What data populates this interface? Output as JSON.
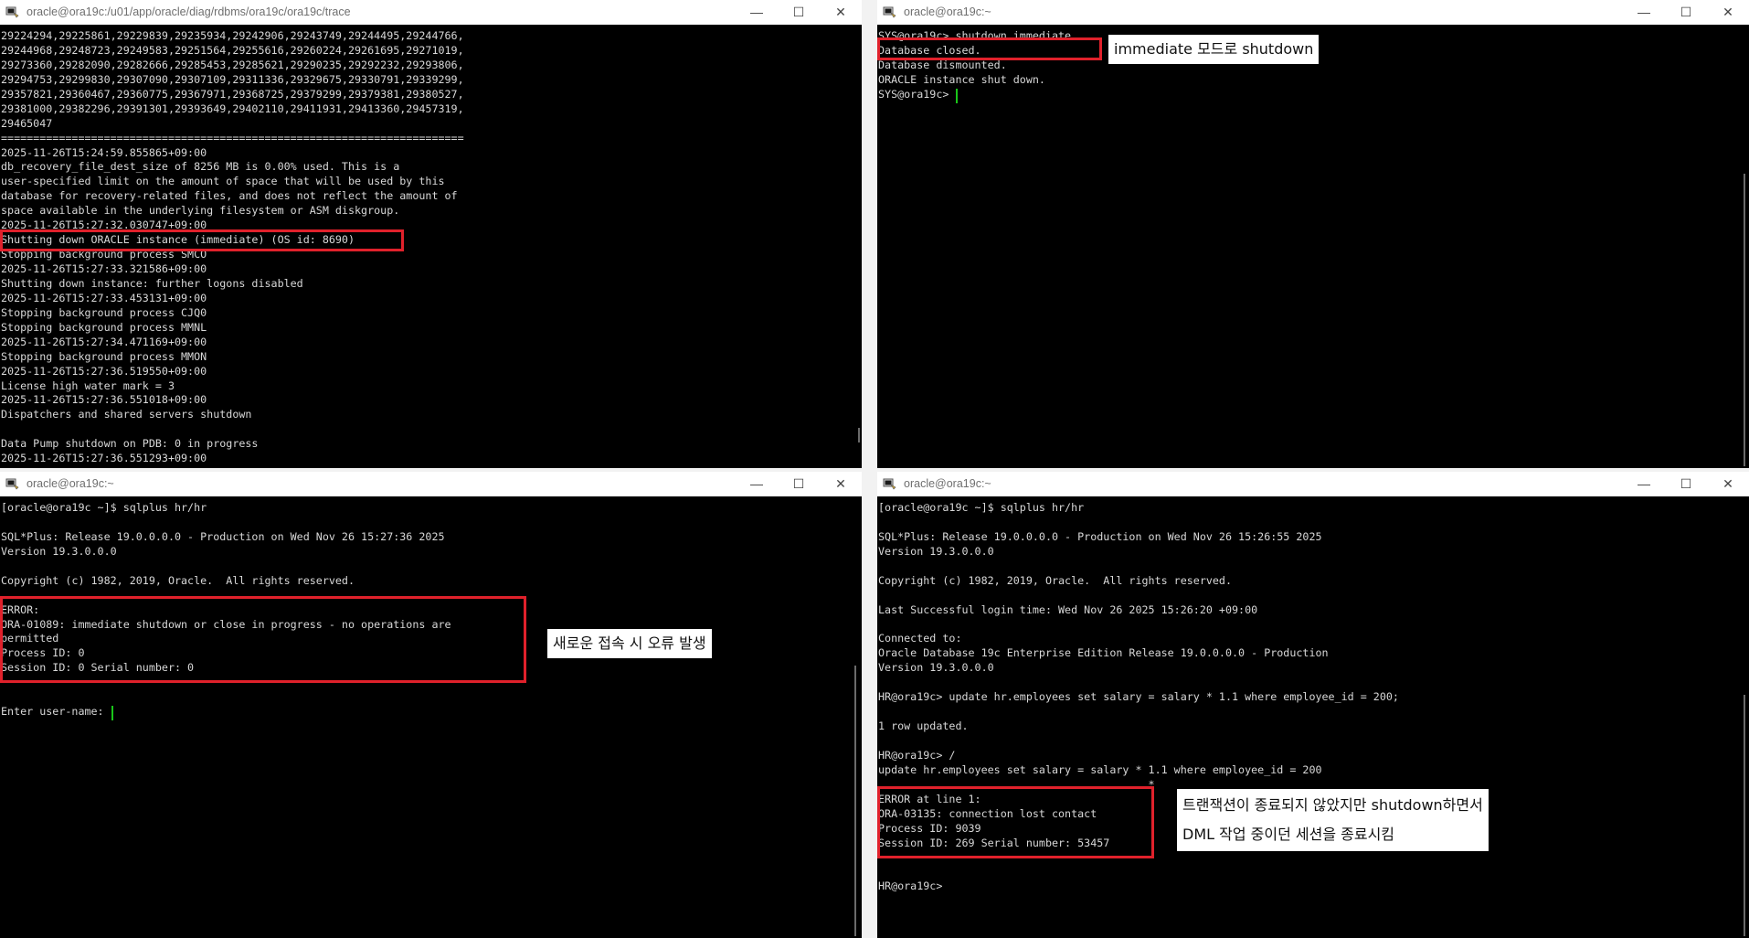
{
  "windows": {
    "top_left": {
      "title": "oracle@ora19c:/u01/app/oracle/diag/rdbms/ora19c/ora19c/trace",
      "lines": [
        "29224294,29225861,29229839,29235934,29242906,29243749,29244495,29244766,",
        "29244968,29248723,29249583,29251564,29255616,29260224,29261695,29271019,",
        "29273360,29282090,29282666,29285453,29285621,29290235,29292232,29293806,",
        "29294753,29299830,29307090,29307109,29311336,29329675,29330791,29339299,",
        "29357821,29360467,29360775,29367971,29368725,29379299,29379381,29380527,",
        "29381000,29382296,29391301,29393649,29402110,29411931,29413360,29457319,",
        "29465047",
        "========================================================================",
        "2025-11-26T15:24:59.855865+09:00",
        "db_recovery_file_dest_size of 8256 MB is 0.00% used. This is a",
        "user-specified limit on the amount of space that will be used by this",
        "database for recovery-related files, and does not reflect the amount of",
        "space available in the underlying filesystem or ASM diskgroup.",
        "2025-11-26T15:27:32.030747+09:00",
        "Shutting down ORACLE instance (immediate) (OS id: 8690)",
        "Stopping background process SMCO",
        "2025-11-26T15:27:33.321586+09:00",
        "Shutting down instance: further logons disabled",
        "2025-11-26T15:27:33.453131+09:00",
        "Stopping background process CJQ0",
        "Stopping background process MMNL",
        "2025-11-26T15:27:34.471169+09:00",
        "Stopping background process MMON",
        "2025-11-26T15:27:36.519550+09:00",
        "License high water mark = 3",
        "2025-11-26T15:27:36.551018+09:00",
        "Dispatchers and shared servers shutdown",
        "",
        "Data Pump shutdown on PDB: 0 in progress",
        "2025-11-26T15:27:36.551293+09:00"
      ]
    },
    "top_right": {
      "title": "oracle@ora19c:~",
      "lines": [
        "SYS@ora19c> shutdown immediate",
        "Database closed.",
        "Database dismounted.",
        "ORACLE instance shut down."
      ],
      "prompt": "SYS@ora19c> ",
      "annotation": "immediate 모드로 shutdown"
    },
    "bottom_left": {
      "title": "oracle@ora19c:~",
      "lines": [
        "[oracle@ora19c ~]$ sqlplus hr/hr",
        "",
        "SQL*Plus: Release 19.0.0.0.0 - Production on Wed Nov 26 15:27:36 2025",
        "Version 19.3.0.0.0",
        "",
        "Copyright (c) 1982, 2019, Oracle.  All rights reserved.",
        "",
        "ERROR:",
        "ORA-01089: immediate shutdown or close in progress - no operations are",
        "permitted",
        "Process ID: 0",
        "Session ID: 0 Serial number: 0",
        "",
        ""
      ],
      "prompt": "Enter user-name: ",
      "annotation": "새로운 접속 시 오류 발생"
    },
    "bottom_right": {
      "title": "oracle@ora19c:~",
      "lines": [
        "[oracle@ora19c ~]$ sqlplus hr/hr",
        "",
        "SQL*Plus: Release 19.0.0.0.0 - Production on Wed Nov 26 15:26:55 2025",
        "Version 19.3.0.0.0",
        "",
        "Copyright (c) 1982, 2019, Oracle.  All rights reserved.",
        "",
        "Last Successful login time: Wed Nov 26 2025 15:26:20 +09:00",
        "",
        "Connected to:",
        "Oracle Database 19c Enterprise Edition Release 19.0.0.0.0 - Production",
        "Version 19.3.0.0.0",
        "",
        "HR@ora19c> update hr.employees set salary = salary * 1.1 where employee_id = 200;",
        "",
        "1 row updated.",
        "",
        "HR@ora19c> /",
        "update hr.employees set salary = salary * 1.1 where employee_id = 200",
        "                                          *",
        "ERROR at line 1:",
        "ORA-03135: connection lost contact",
        "Process ID: 9039",
        "Session ID: 269 Serial number: 53457",
        "",
        ""
      ],
      "prompt": "HR@ora19c> ",
      "annotation_line1": "트랜잭션이 종료되지 않았지만 shutdown하면서",
      "annotation_line2": "DML 작업 중이던 세션을 종료시킴"
    }
  },
  "controls": {
    "minimize": "—",
    "maximize": "☐",
    "close": "✕"
  }
}
